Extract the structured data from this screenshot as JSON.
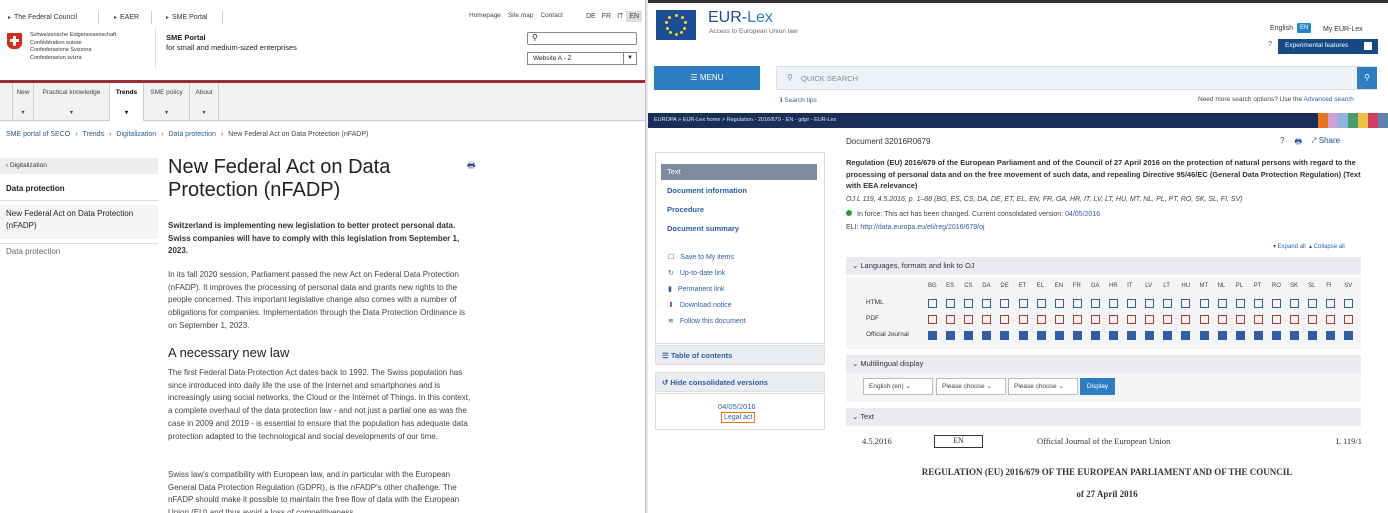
{
  "left": {
    "top_crumbs": [
      "The Federal Council",
      "EAER",
      "SME Portal"
    ],
    "top_links": [
      "Homepage",
      "Site map",
      "Contact"
    ],
    "langs": [
      "DE",
      "FR",
      "IT",
      "EN"
    ],
    "active_lang": "EN",
    "logo_lines": [
      "Schweizerische Eidgenossenschaft",
      "Confédération suisse",
      "Confederazione Svizzera",
      "Confederaziun svizra"
    ],
    "portal_title": "SME Portal",
    "portal_sub": "for small and medium-sized enterprises",
    "search_icon": "search-icon",
    "select_value": "Website A - Z",
    "nav": [
      "New",
      "Practical knowledge",
      "Trends",
      "SME policy",
      "About"
    ],
    "nav_active": "Trends",
    "breadcrumb": [
      "SME portal of SECO",
      "Trends",
      "Digitalization",
      "Data protection",
      "New Federal Act on Data Protection (nFADP)"
    ],
    "sidebar": {
      "back": "Digitalization",
      "heading": "Data protection",
      "current": "New Federal Act on Data Protection (nFADP)",
      "other": "Data protection"
    },
    "title": "New Federal Act on Data Protection (nFADP)",
    "lead": "Switzerland is implementing new legislation to better protect personal data. Swiss companies will have to comply with this legislation from September 1, 2023.",
    "para1": "In its fall 2020 session, Parliament passed the new Act on Federal Data Protection (nFADP). It improves the processing of personal data and grants new rights to the people concerned. This important legislative change also comes with a number of obligations for companies. Implementation through the Data Protection Ordinance is on September 1, 2023.",
    "h2": "A necessary new law",
    "para2": "The first Federal Data Protection Act dates back to 1992. The Swiss population has since introduced into daily life the use of the Internet and smartphones and is increasingly using social networks, the Cloud or the Internet of Things. In this context, a complete overhaul of the data protection law - and not just a partial one as was the case in 2009 and 2019 - is essential to ensure that the population has adequate data protection adapted to the technological and social developments of our time.",
    "para3": "Swiss law's compatibility with European law, and in particular with the European General Data Protection Regulation (GDPR), is the nFADP's other challenge. The nFADP should make it possible to maintain the free flow of data with the European Union (EU) and thus avoid a loss of competitiveness"
  },
  "right": {
    "brand_a": "EUR-",
    "brand_b": "Lex",
    "brand_sub": "Access to European Union law",
    "lang_label": "English",
    "lang_badge": "EN",
    "my_eurlex": "My EUR-Lex",
    "experimental": "Experimental features",
    "menu": "MENU",
    "quick_search": "QUICK SEARCH",
    "search_tips": "Search tips",
    "more_options": "Need more search options? Use the",
    "advanced": "Advanced search",
    "europa_bar": "EUROPA   >   EUR-Lex home   >   Regulation - 2016/679 - EN - gdpr - EUR-Lex",
    "doc_id": "Document 32016R0679",
    "share": "Share",
    "reg_title": "Regulation (EU) 2016/679 of the European Parliament and of the Council of 27 April 2016 on the protection of natural persons with regard to the processing of personal data and on the free movement of such data, and repealing Directive 95/46/EC (General Data Protection Regulation) (Text with EEA relevance)",
    "oj": "OJ L 119, 4.5.2016, p. 1–88 (BG, ES, CS, DA, DE, ET, EL, EN, FR, GA, HR, IT, LV, LT, HU, MT, NL, PL, PT, RO, SK, SL, FI, SV)",
    "in_force": "In force: This act has been changed. Current consolidated version:",
    "in_force_date": "04/05/2016",
    "eli_label": "ELI:",
    "eli_url": "http://data.europa.eu/eli/reg/2016/679/oj",
    "expand": "▾ Expand all",
    "collapse": "▴ Collapse all",
    "panel": {
      "text": "Text",
      "links": [
        "Document information",
        "Procedure",
        "Document summary"
      ],
      "small": [
        "Save to My items",
        "Up-to-date link",
        "Permanent link",
        "Download notice",
        "Follow this document"
      ],
      "toc": "Table of contents",
      "hide": "Hide consolidated versions",
      "version_date": "04/05/2016",
      "legal_act": "Legal act"
    },
    "sec_langs": "Languages, formats and link to OJ",
    "lang_codes": [
      "BG",
      "ES",
      "CS",
      "DA",
      "DE",
      "ET",
      "EL",
      "EN",
      "FR",
      "GA",
      "HR",
      "IT",
      "LV",
      "LT",
      "HU",
      "MT",
      "NL",
      "PL",
      "PT",
      "RO",
      "SK",
      "SL",
      "FI",
      "SV"
    ],
    "row_labels": [
      "HTML",
      "PDF",
      "Official Journal"
    ],
    "sec_multi": "Multilingual display",
    "multi_sel1": "English (en)",
    "multi_sel2": "Please choose",
    "multi_sel3": "Please choose",
    "display": "Display",
    "sec_text": "Text",
    "oj_date": "4.5.2016",
    "oj_lang": "EN",
    "oj_name": "Official Journal of the European Union",
    "oj_ref": "L 119/1",
    "reg_heading": "REGULATION (EU) 2016/679 OF THE EUROPEAN PARLIAMENT AND OF THE COUNCIL",
    "reg_date": "of 27 April 2016"
  }
}
